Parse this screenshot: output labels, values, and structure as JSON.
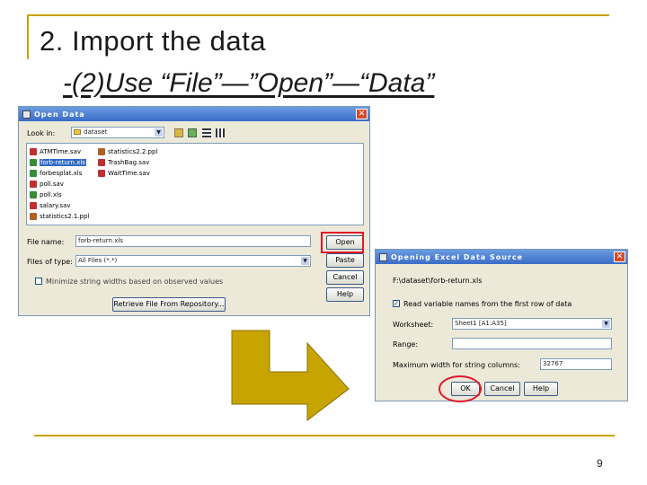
{
  "slide": {
    "title": "2. Import the data",
    "subtitle": "-(2)Use “File”—”Open”—“Data”",
    "page_number": "9"
  },
  "open_dialog": {
    "title": "Open Data",
    "look_in_label": "Look in:",
    "look_in_value": "dataset",
    "files_col1": [
      "ATMTime.sav",
      "forb-return.xls",
      "forbesplat.xls",
      "poll.sav",
      "poll.xls",
      "salary.sav",
      "statistics2.1.ppl"
    ],
    "files_col2": [
      "statistics2.2.ppl",
      "TrashBag.sav",
      "WaitTime.sav"
    ],
    "selected_file": "forb-return.xls",
    "file_name_label": "File name:",
    "file_name_value": "forb-return.xls",
    "files_of_type_label": "Files of type:",
    "files_of_type_value": "All Files (*.*)",
    "minimize_label": "Minimize string widths based on observed values",
    "retrieve_label": "Retrieve File From Repository...",
    "buttons": {
      "open": "Open",
      "paste": "Paste",
      "cancel": "Cancel",
      "help": "Help"
    }
  },
  "excel_dialog": {
    "title": "Opening Excel Data Source",
    "path": "F:\\dataset\\forb-return.xls",
    "read_names_label": "Read variable names from the first row of data",
    "read_names_checked": true,
    "worksheet_label": "Worksheet:",
    "worksheet_value": "Sheet1 [A1:A35]",
    "range_label": "Range:",
    "range_value": "",
    "max_width_label": "Maximum width for string columns:",
    "max_width_value": "32767",
    "buttons": {
      "ok": "OK",
      "cancel": "Cancel",
      "help": "Help"
    }
  },
  "colors": {
    "accent_gold": "#c8a400",
    "highlight_red": "#e0182c",
    "titlebar_blue": "#3a6cc8",
    "selection_blue": "#316ac5"
  },
  "icons": {
    "arrow": "l-shaped-right-arrow",
    "sav_file": "spss-data-file-icon",
    "xls_file": "excel-file-icon",
    "ppl_file": "spss-output-file-icon"
  }
}
